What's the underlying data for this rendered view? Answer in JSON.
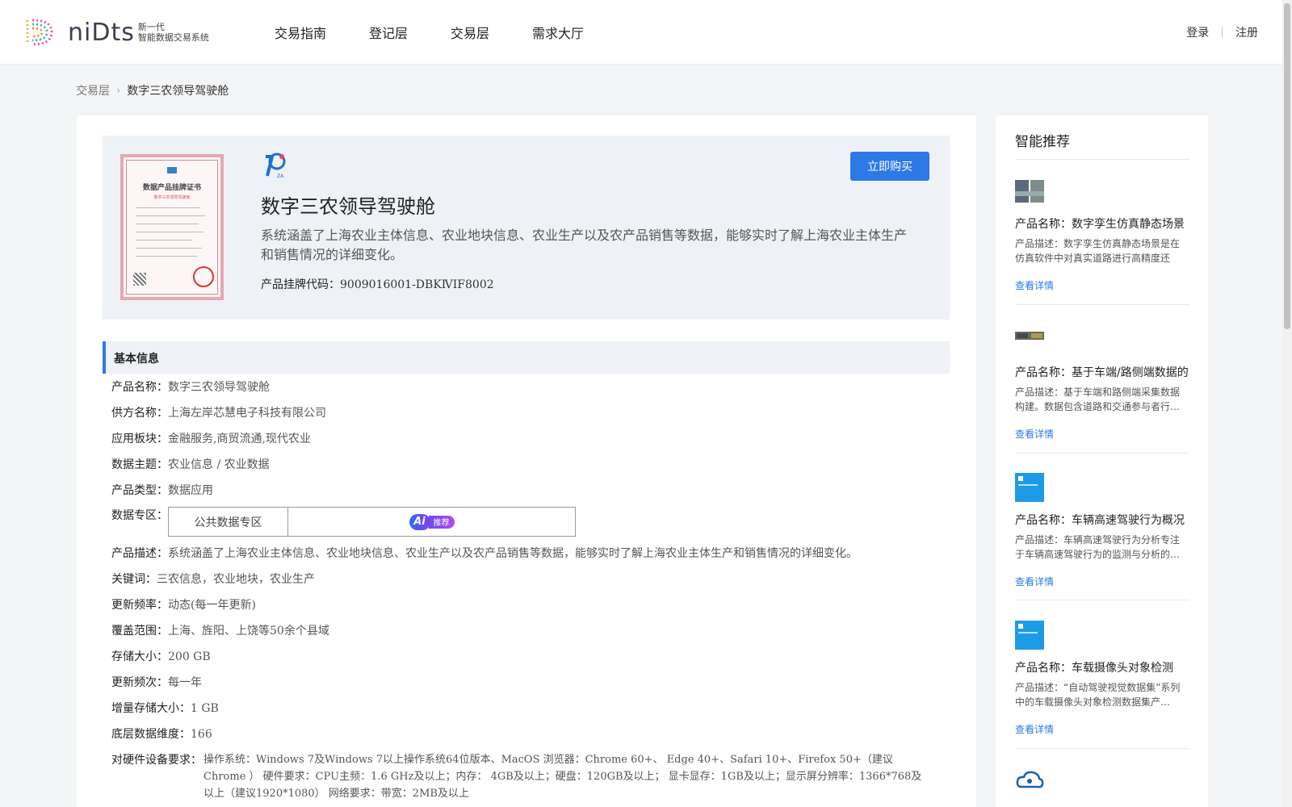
{
  "header": {
    "logo_word": "niDts",
    "logo_sub1": "新一代",
    "logo_sub2": "智能数据交易系统",
    "nav": [
      "交易指南",
      "登记层",
      "交易层",
      "需求大厅"
    ],
    "login": "登录",
    "register": "注册"
  },
  "breadcrumb": {
    "parent": "交易层",
    "current": "数字三农领导驾驶舱"
  },
  "product": {
    "title": "数字三农领导驾驶舱",
    "description": "系统涵盖了上海农业主体信息、农业地块信息、农业生产以及农产品销售等数据，能够实时了解上海农业主体生产和销售情况的详细变化。",
    "code_label": "产品挂牌代码：",
    "code_value": "9009016001-DBKⅣIF8002",
    "buy_label": "立即购买",
    "cert_title": "数据产品挂牌证书",
    "cert_sub": "数字三农领导驾驶舱"
  },
  "basic": {
    "heading": "基本信息",
    "rows": [
      {
        "k": "产品名称：",
        "v": "数字三农领导驾驶舱"
      },
      {
        "k": "供方名称：",
        "v": "上海左岸芯慧电子科技有限公司"
      },
      {
        "k": "应用板块：",
        "v": "金融服务,商贸流通,现代农业"
      },
      {
        "k": "数据主题：",
        "v": "农业信息 / 农业数据"
      },
      {
        "k": "产品类型：",
        "v": "数据应用"
      },
      {
        "k": "数据专区：",
        "v": ""
      },
      {
        "k": "产品描述：",
        "v": "系统涵盖了上海农业主体信息、农业地块信息、农业生产以及农产品销售等数据，能够实时了解上海农业主体生产和销售情况的详细变化。"
      },
      {
        "k": "关键词：",
        "v": "三农信息，农业地块，农业生产"
      },
      {
        "k": "更新频率：",
        "v": "动态(每一年更新)"
      },
      {
        "k": "覆盖范围：",
        "v": "上海、旌阳、上饶等50余个县域"
      },
      {
        "k": "存储大小：",
        "v": "200 GB"
      },
      {
        "k": "更新频次：",
        "v": "每一年"
      },
      {
        "k": "增量存储大小：",
        "v": "1 GB"
      },
      {
        "k": "底层数据维度：",
        "v": "166"
      }
    ],
    "zone_public": "公共数据专区",
    "ai_a": "Ai",
    "ai_tag": "推荐",
    "hw_label": "对硬件设备要求：",
    "hw_value": "操作系统：Windows 7及Windows 7以上操作系统64位版本、MacOS 浏览器：Chrome 60+、 Edge 40+、Safari 10+、Firefox 50+（建议Chrome ） 硬件要求：CPU主频：1.6 GHz及以上；内存： 4GB及以上；硬盘：120GB及以上； 显卡显存：1GB及以上；显示屏分辨率：1366*768及以上（建议1920*1080） 网络要求：带宽：2MB及以上"
  },
  "sidebar": {
    "title": "智能推荐",
    "items": [
      {
        "name": "产品名称：数字孪生仿真静态场景",
        "desc": "产品描述：数字孪生仿真静态场景是在仿真软件中对真实道路进行高精度还原…",
        "link": "查看详情"
      },
      {
        "name": "产品名称：基于车端/路侧端数据的",
        "desc": "产品描述：基于车端和路侧端采集数据构建。数据包含道路和交通参与者行…",
        "link": "查看详情"
      },
      {
        "name": "产品名称：车辆高速驾驶行为概况",
        "desc": "产品描述：车辆高速驾驶行为分析专注于车辆高速驾驶行为的监测与分析的…",
        "link": "查看详情"
      },
      {
        "name": "产品名称：车载摄像头对象检测",
        "desc": "产品描述：“自动驾驶视觉数据集”系列中的车载摄像头对象检测数据集产…",
        "link": "查看详情"
      }
    ]
  },
  "colors": {
    "accent": "#2d7ae6",
    "panel": "#eef1f5",
    "background": "#f4f5f7"
  }
}
